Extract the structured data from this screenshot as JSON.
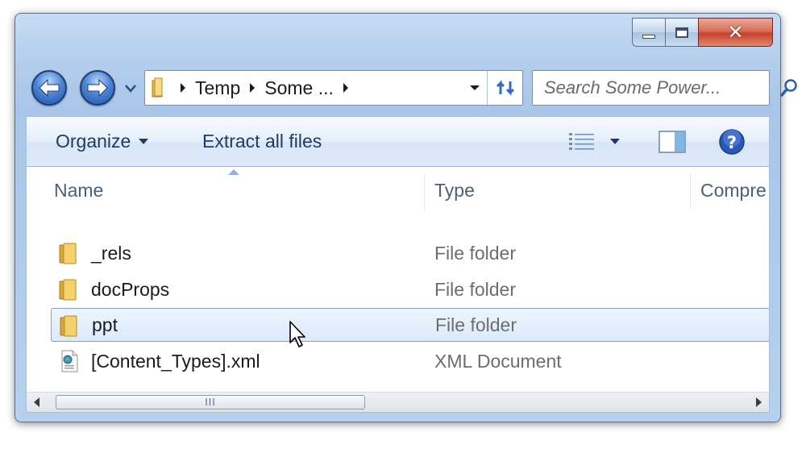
{
  "address": {
    "crumbs": [
      "Temp",
      "Some ..."
    ]
  },
  "search": {
    "placeholder": "Search Some Power..."
  },
  "toolbar": {
    "organize_label": "Organize",
    "extract_label": "Extract all files"
  },
  "columns": {
    "name": "Name",
    "type": "Type",
    "compressed": "Compre"
  },
  "files": [
    {
      "name": "_rels",
      "type": "File folder",
      "icon": "folder-icon",
      "selected": false
    },
    {
      "name": "docProps",
      "type": "File folder",
      "icon": "folder-icon",
      "selected": false
    },
    {
      "name": "ppt",
      "type": "File folder",
      "icon": "folder-icon",
      "selected": true
    },
    {
      "name": "[Content_Types].xml",
      "type": "XML Document",
      "icon": "xml-file-icon",
      "selected": false
    }
  ],
  "scrollbar": {
    "grip": "III"
  },
  "colors": {
    "window_frame": "#b3cdec",
    "close_button": "#c6402a",
    "toolbar_text": "#1e3a5f",
    "selection": "#dbe9fb"
  }
}
